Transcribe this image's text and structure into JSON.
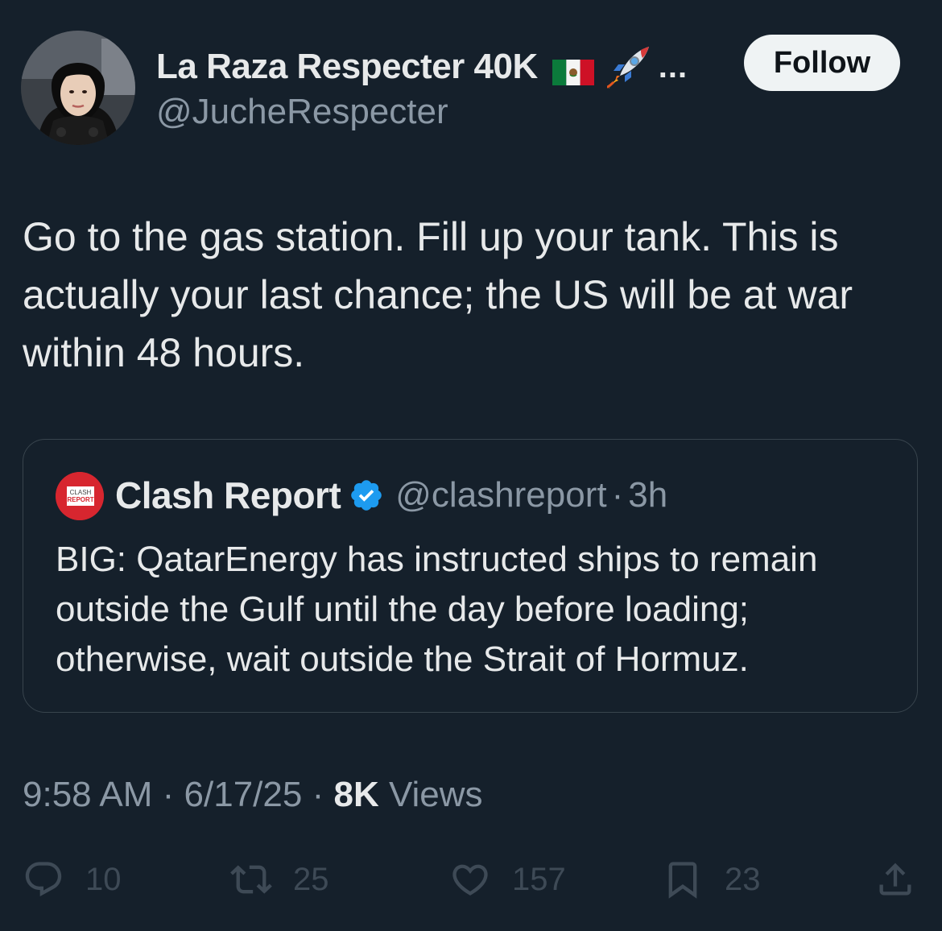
{
  "author": {
    "display_name": "La Raza Respecter 40K",
    "truncation": "...",
    "handle": "@JucheRespecter",
    "follow_label": "Follow"
  },
  "tweet": {
    "text": "Go to the gas station. Fill up your tank. This is actually your last chance; the US will be at war within 48 hours."
  },
  "quoted": {
    "name": "Clash Report",
    "handle": "@clashreport",
    "separator": "·",
    "time": "3h",
    "text": "BIG: QatarEnergy has instructed ships to remain outside the Gulf until the day before loading; otherwise, wait outside the Strait of Hormuz.",
    "avatar_text_top": "CLASH",
    "avatar_text_bottom": "REPORT"
  },
  "meta": {
    "time": "9:58 AM",
    "sep1": " · ",
    "date": "6/17/25",
    "sep2": " · ",
    "views_count": "8K",
    "views_label": " Views"
  },
  "actions": {
    "replies": "10",
    "reposts": "25",
    "likes": "157",
    "bookmarks": "23"
  },
  "colors": {
    "background": "#15202b",
    "primary_text": "#e7e9ea",
    "secondary_text": "#8b98a5",
    "verified_blue": "#1d9bf0",
    "brand_red": "#d7262f"
  }
}
